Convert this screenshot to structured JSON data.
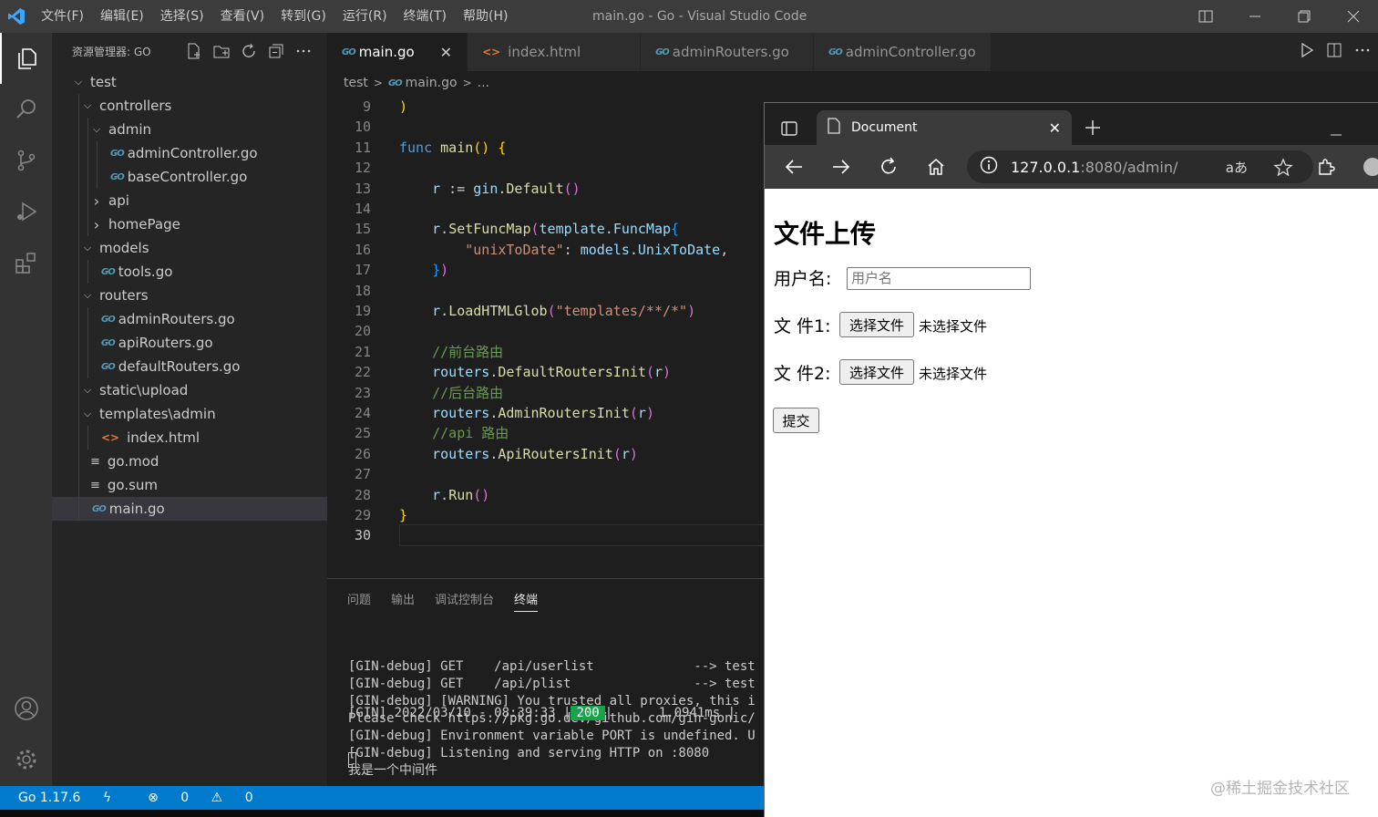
{
  "titlebar": {
    "menu": [
      "文件(F)",
      "编辑(E)",
      "选择(S)",
      "查看(V)",
      "转到(G)",
      "运行(R)",
      "终端(T)",
      "帮助(H)"
    ],
    "title": "main.go - Go - Visual Studio Code"
  },
  "sidebar": {
    "header": "资源管理器: GO",
    "tree": [
      {
        "label": "test",
        "depth": 0,
        "kind": "folder-open"
      },
      {
        "label": "controllers",
        "depth": 1,
        "kind": "folder-open"
      },
      {
        "label": "admin",
        "depth": 2,
        "kind": "folder-open"
      },
      {
        "label": "adminController.go",
        "depth": 3,
        "kind": "go"
      },
      {
        "label": "baseController.go",
        "depth": 3,
        "kind": "go"
      },
      {
        "label": "api",
        "depth": 2,
        "kind": "folder-closed"
      },
      {
        "label": "homePage",
        "depth": 2,
        "kind": "folder-closed"
      },
      {
        "label": "models",
        "depth": 1,
        "kind": "folder-open"
      },
      {
        "label": "tools.go",
        "depth": 2,
        "kind": "go"
      },
      {
        "label": "routers",
        "depth": 1,
        "kind": "folder-open"
      },
      {
        "label": "adminRouters.go",
        "depth": 2,
        "kind": "go"
      },
      {
        "label": "apiRouters.go",
        "depth": 2,
        "kind": "go"
      },
      {
        "label": "defaultRouters.go",
        "depth": 2,
        "kind": "go"
      },
      {
        "label": "static\\upload",
        "depth": 1,
        "kind": "folder-open"
      },
      {
        "label": "templates\\admin",
        "depth": 1,
        "kind": "folder-open"
      },
      {
        "label": "index.html",
        "depth": 2,
        "kind": "html"
      },
      {
        "label": "go.mod",
        "depth": 1,
        "kind": "mod"
      },
      {
        "label": "go.sum",
        "depth": 1,
        "kind": "mod"
      },
      {
        "label": "main.go",
        "depth": 1,
        "kind": "go",
        "selected": true
      }
    ]
  },
  "tabs": [
    {
      "label": "main.go",
      "icon": "go",
      "active": true
    },
    {
      "label": "index.html",
      "icon": "html"
    },
    {
      "label": "adminRouters.go",
      "icon": "go"
    },
    {
      "label": "adminController.go",
      "icon": "go"
    }
  ],
  "breadcrumb": {
    "folder": "test",
    "file": "main.go",
    "tail": "..."
  },
  "code": {
    "current_line": 30,
    "lines": [
      {
        "n": 9,
        "html": "<span class=\"br\">)</span>"
      },
      {
        "n": 10,
        "html": ""
      },
      {
        "n": 11,
        "html": "<span class=\"kw\">func</span> <span class=\"fn\">main</span><span class=\"br\">()</span> <span class=\"br\">{</span>"
      },
      {
        "n": 12,
        "html": ""
      },
      {
        "n": 13,
        "html": "    <span class=\"vr\">r</span> := <span class=\"vr\">gin</span>.<span class=\"fn\">Default</span><span class=\"br2\">()</span>"
      },
      {
        "n": 14,
        "html": ""
      },
      {
        "n": 15,
        "html": "    <span class=\"vr\">r</span>.<span class=\"fn\">SetFuncMap</span><span class=\"br2\">(</span><span class=\"vr\">template</span>.<span class=\"vr\">FuncMap</span><span class=\"br3\">{</span>"
      },
      {
        "n": 16,
        "html": "        <span class=\"str\">\"unixToDate\"</span>: <span class=\"vr\">models</span>.<span class=\"vr\">UnixToDate</span>,"
      },
      {
        "n": 17,
        "html": "    <span class=\"br3\">}</span><span class=\"br2\">)</span>"
      },
      {
        "n": 18,
        "html": ""
      },
      {
        "n": 19,
        "html": "    <span class=\"vr\">r</span>.<span class=\"fn\">LoadHTMLGlob</span><span class=\"br2\">(</span><span class=\"str\">\"templates/**/*\"</span><span class=\"br2\">)</span>"
      },
      {
        "n": 20,
        "html": ""
      },
      {
        "n": 21,
        "html": "    <span class=\"cm\">//前台路由</span>"
      },
      {
        "n": 22,
        "html": "    <span class=\"vr\">routers</span>.<span class=\"fn\">DefaultRoutersInit</span><span class=\"br2\">(</span><span class=\"vr\">r</span><span class=\"br2\">)</span>"
      },
      {
        "n": 23,
        "html": "    <span class=\"cm\">//后台路由</span>"
      },
      {
        "n": 24,
        "html": "    <span class=\"vr\">routers</span>.<span class=\"fn\">AdminRoutersInit</span><span class=\"br2\">(</span><span class=\"vr\">r</span><span class=\"br2\">)</span>"
      },
      {
        "n": 25,
        "html": "    <span class=\"cm\">//api 路由</span>"
      },
      {
        "n": 26,
        "html": "    <span class=\"vr\">routers</span>.<span class=\"fn\">ApiRoutersInit</span><span class=\"br2\">(</span><span class=\"vr\">r</span><span class=\"br2\">)</span>"
      },
      {
        "n": 27,
        "html": ""
      },
      {
        "n": 28,
        "html": "    <span class=\"vr\">r</span>.<span class=\"fn\">Run</span><span class=\"br2\">()</span>"
      },
      {
        "n": 29,
        "html": "<span class=\"br\">}</span>"
      },
      {
        "n": 30,
        "html": ""
      }
    ]
  },
  "panel": {
    "tabs": [
      "问题",
      "输出",
      "调试控制台",
      "终端"
    ],
    "active_tab": "终端",
    "terminal": [
      "[GIN-debug] GET    /api/userlist             --> test",
      "[GIN-debug] GET    /api/plist                --> test",
      "[GIN-debug] [WARNING] You trusted all proxies, this i",
      "Please check https://pkg.go.dev/github.com/gin-gonic/",
      "[GIN-debug] Environment variable PORT is undefined. U",
      "[GIN-debug] Listening and serving HTTP on :8080",
      "我是一个中间件"
    ],
    "log_prefix": "[GIN] 2022/03/10 - 08:39:33 |",
    "log_status": "200",
    "log_suffix": "|      1.0941ms |"
  },
  "statusbar": {
    "go_version": "Go 1.17.6",
    "errors": "0",
    "warnings": "0"
  },
  "browser": {
    "tab_title": "Document",
    "url_host": "127.0.0.1",
    "url_rest": ":8080/admin/",
    "page": {
      "heading": "文件上传",
      "username_label": "用户名:",
      "username_placeholder": "用户名",
      "file1_label": "文 件1:",
      "file2_label": "文 件2:",
      "choose_file": "选择文件",
      "no_file": "未选择文件",
      "submit": "提交"
    }
  },
  "watermark": "@稀土掘金技术社区",
  "colors": {
    "accent": "#007acc",
    "status_ok": "#16a34a"
  }
}
